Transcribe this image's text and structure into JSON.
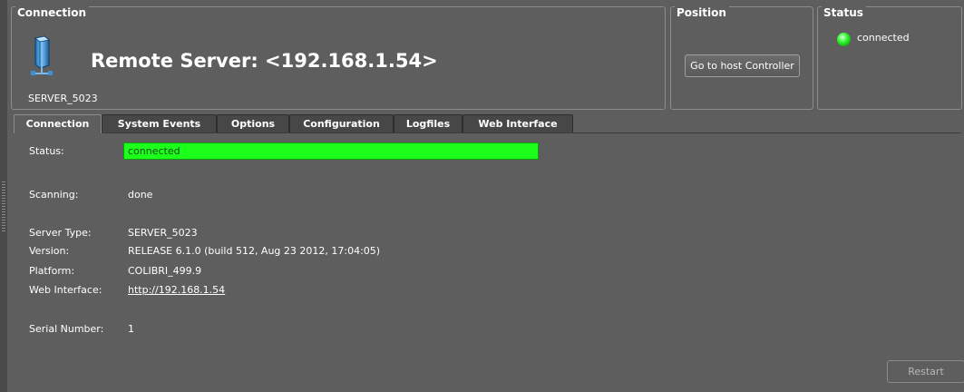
{
  "connection_group": {
    "legend": "Connection",
    "server_title": "Remote Server: <192.168.1.54>",
    "server_name": "SERVER_5023",
    "icon": "server-icon"
  },
  "position_group": {
    "legend": "Position",
    "host_button": "Go to host Controller"
  },
  "status_group": {
    "legend": "Status",
    "status_text": "connected",
    "led_color": "#22ee22"
  },
  "tabs": [
    {
      "label": "Connection",
      "active": true
    },
    {
      "label": "System Events",
      "active": false
    },
    {
      "label": "Options",
      "active": false
    },
    {
      "label": "Configuration",
      "active": false
    },
    {
      "label": "Logfiles",
      "active": false
    },
    {
      "label": "Web Interface",
      "active": false
    }
  ],
  "details": {
    "status_label": "Status:",
    "status_value": "connected",
    "status_color": "#1bff1b",
    "scanning_label": "Scanning:",
    "scanning_value": "done",
    "server_type_label": "Server Type:",
    "server_type_value": "SERVER_5023",
    "version_label": "Version:",
    "version_value": "RELEASE 6.1.0 (build 512, Aug 23 2012, 17:04:05)",
    "platform_label": "Platform:",
    "platform_value": "COLIBRI_499.9",
    "web_label": "Web Interface:",
    "web_value": "http://192.168.1.54",
    "serial_label": "Serial Number:",
    "serial_value": "1"
  },
  "restart_button": "Restart"
}
